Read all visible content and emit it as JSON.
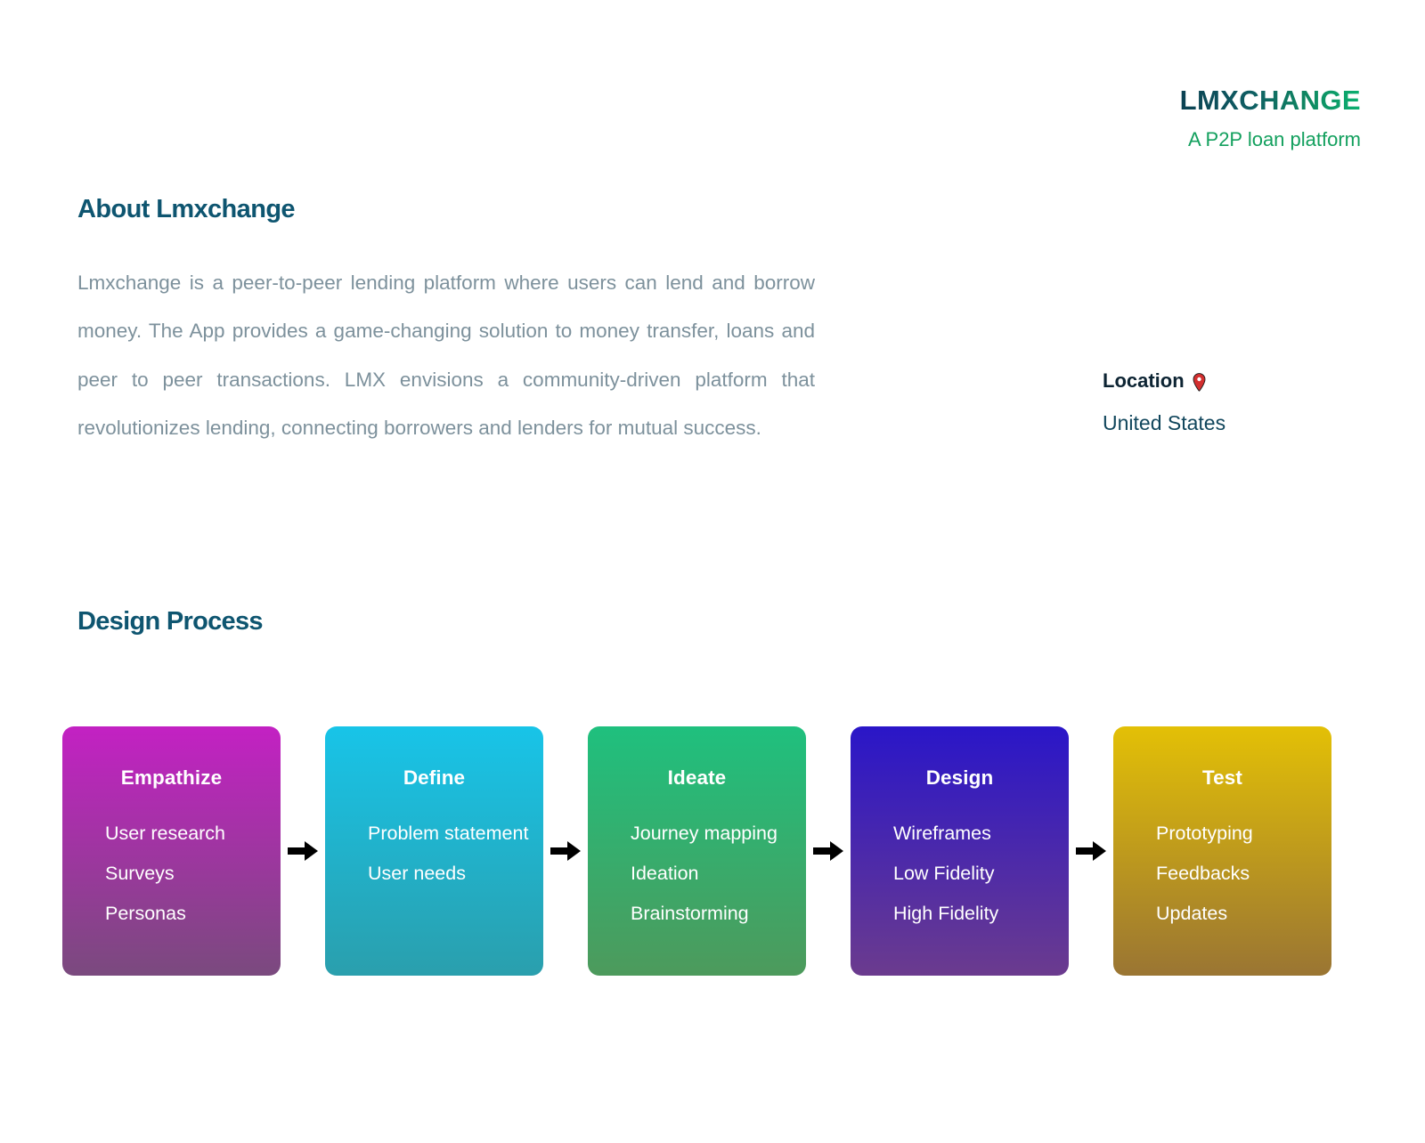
{
  "brand": {
    "name": "LMXCHANGE",
    "tagline": "A P2P loan platform",
    "gradient_from": "#0b4152",
    "gradient_to": "#0bb070",
    "tagline_color": "#13a05e"
  },
  "location": {
    "label": "Location",
    "icon": "map-pin-icon",
    "icon_color": "#d32f2f",
    "value": "United States"
  },
  "about": {
    "title": "About Lmxchange",
    "body": "Lmxchange is a peer-to-peer lending platform where users can lend and borrow money. The App provides a game-changing solution to money transfer, loans and peer to peer transactions. LMX envisions a community-driven platform that revolutionizes lending, connecting borrowers and lenders for mutual success.",
    "title_color": "#0e5570",
    "body_color": "#7d919c"
  },
  "process": {
    "title": "Design Process",
    "arrow_icon": "arrow-right-icon",
    "arrow_color": "#000000",
    "stages": [
      {
        "name": "Empathize",
        "items": [
          "User research",
          "Surveys",
          "Personas"
        ],
        "gradient_top": "#c321c3",
        "gradient_bottom": "#7a4a7e"
      },
      {
        "name": "Define",
        "items": [
          "Problem statement",
          "User needs"
        ],
        "gradient_top": "#18c4e8",
        "gradient_bottom": "#2a9fad"
      },
      {
        "name": "Ideate",
        "items": [
          "Journey mapping",
          "Ideation",
          "Brainstorming"
        ],
        "gradient_top": "#1fc07e",
        "gradient_bottom": "#4d9a5c"
      },
      {
        "name": "Design",
        "items": [
          "Wireframes",
          "Low Fidelity",
          "High Fidelity"
        ],
        "gradient_top": "#2a16c8",
        "gradient_bottom": "#6b3b8e"
      },
      {
        "name": "Test",
        "items": [
          "Prototyping",
          "Feedbacks",
          "Updates"
        ],
        "gradient_top": "#e3c006",
        "gradient_bottom": "#9a7533"
      }
    ]
  }
}
